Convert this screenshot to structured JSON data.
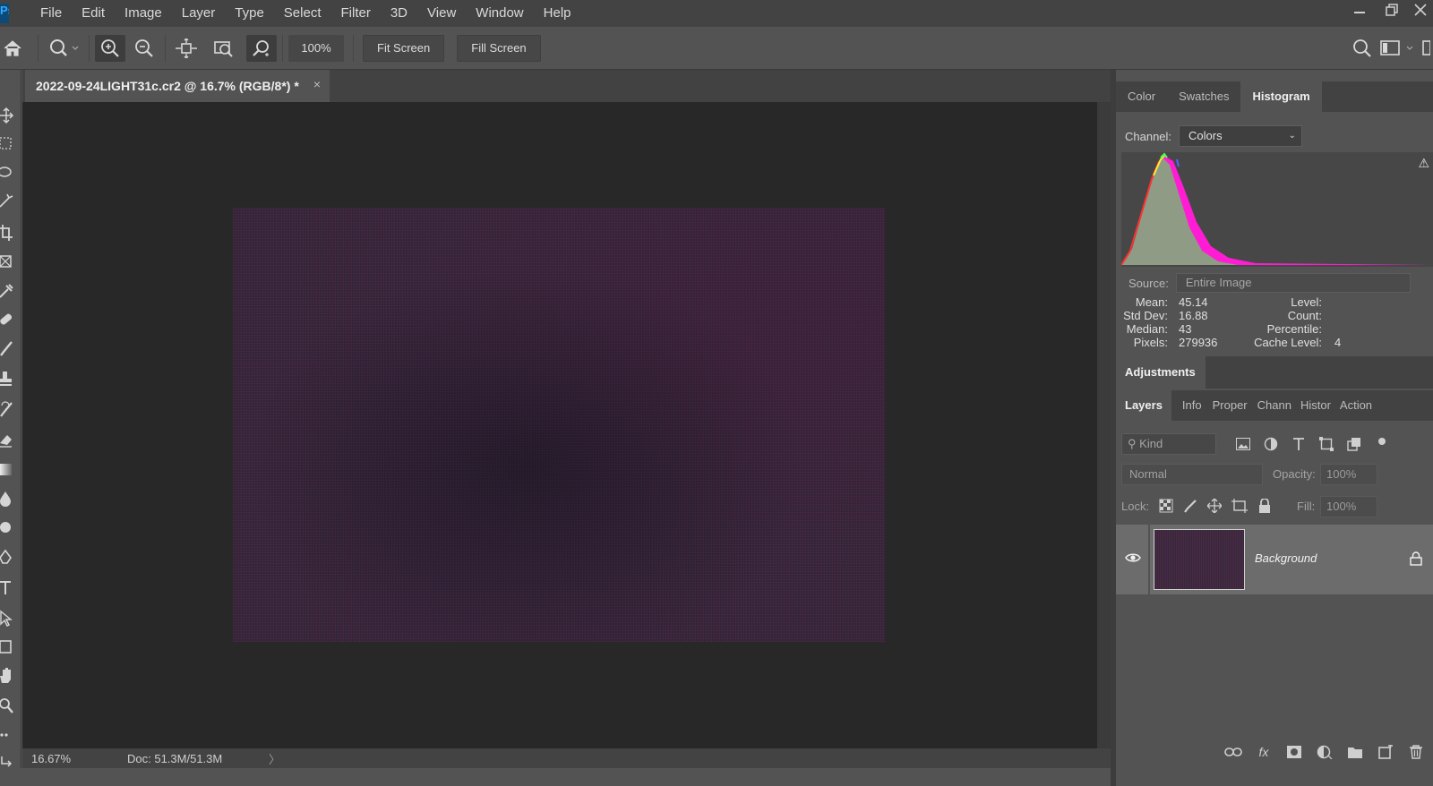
{
  "app": {
    "logo_text": "Ps"
  },
  "menu": [
    "File",
    "Edit",
    "Image",
    "Layer",
    "Type",
    "Select",
    "Filter",
    "3D",
    "View",
    "Window",
    "Help"
  ],
  "options_bar": {
    "zoom_value": "100%",
    "fit_screen_label": "Fit Screen",
    "fill_screen_label": "Fill Screen"
  },
  "document": {
    "tab_title": "2022-09-24LIGHT31c.cr2 @ 16.7% (RGB/8*) *",
    "close_glyph": "×"
  },
  "status_bar": {
    "zoom": "16.67%",
    "doc_size": "Doc: 51.3M/51.3M",
    "arrow": "〉"
  },
  "top_panel": {
    "tabs": [
      "Color",
      "Swatches",
      "Histogram"
    ],
    "active_tab": "Histogram",
    "channel_label": "Channel:",
    "channel_value": "Colors",
    "source_label": "Source:",
    "source_value": "Entire Image",
    "stats_left": [
      {
        "label": "Mean:",
        "value": "45.14"
      },
      {
        "label": "Std Dev:",
        "value": "16.88"
      },
      {
        "label": "Median:",
        "value": "43"
      },
      {
        "label": "Pixels:",
        "value": "279936"
      }
    ],
    "stats_right": [
      {
        "label": "Level:",
        "value": ""
      },
      {
        "label": "Count:",
        "value": ""
      },
      {
        "label": "Percentile:",
        "value": ""
      },
      {
        "label": "Cache Level:",
        "value": "4"
      }
    ]
  },
  "adjustments_panel": {
    "title": "Adjustments"
  },
  "layers_panel": {
    "tabs": [
      "Layers",
      "Info",
      "Proper",
      "Chann",
      "Histor",
      "Action"
    ],
    "active_tab": "Layers",
    "kind_placeholder": "Kind",
    "blend_mode": "Normal",
    "opacity_label": "Opacity:",
    "opacity_value": "100%",
    "lock_label": "Lock:",
    "fill_label": "Fill:",
    "fill_value": "100%",
    "layers": [
      {
        "name": "Background",
        "visible": true,
        "locked": true
      }
    ],
    "footer_fx": "fx"
  },
  "colors": {
    "accent": "#31a8ff",
    "histogram_magenta": "#ff1cd4",
    "histogram_gray": "#8f9b84"
  }
}
